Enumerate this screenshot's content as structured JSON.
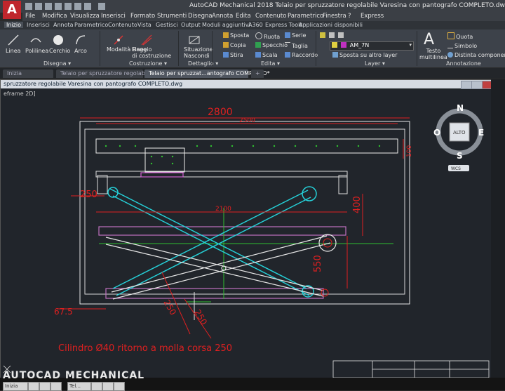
{
  "app": {
    "logo_letter": "A",
    "title": "AutoCAD Mechanical 2018     Telaio per spruzzatore regolabile Varesina con pantografo COMPLETO.dwg"
  },
  "menu": [
    "File",
    "Modifica",
    "Visualizza",
    "Inserisci",
    "Formato",
    "Strumenti",
    "Disegna",
    "Annota",
    "Edita",
    "Contenuto",
    "Parametrico",
    "Finestra",
    "?",
    "Express"
  ],
  "ribbon_tabs": [
    "Inizio",
    "Inserisci",
    "Annota",
    "Parametrico",
    "Contenuto",
    "Vista",
    "Gestisci",
    "Output",
    "Moduli aggiuntivi",
    "A360",
    "Express Tools",
    "Applicazioni disponibili"
  ],
  "ribbon": {
    "disegna": {
      "title": "Disegna ▾",
      "linea": "Linea",
      "polilinea": "Polilinea",
      "cerchio": "Cerchio",
      "arco": "Arco"
    },
    "costruzione": {
      "title": "Costruzione ▾",
      "modalita": "Modalità\nRaggio",
      "linee": "Linee\ndi costruzione"
    },
    "dettaglio": {
      "title": "Dettaglio ▾",
      "situazione": "Situazione\nNascondi"
    },
    "edita": {
      "title": "Edita ▾",
      "sposta": "Sposta",
      "ruota": "Ruota",
      "serie": "Serie",
      "copia": "Copia",
      "specchio": "Specchio",
      "taglia": "Taglia",
      "stira": "Stira",
      "scala": "Scala",
      "raccordo": "Raccordo"
    },
    "layer": {
      "title": "Layer ▾",
      "current": "AM_7N",
      "sposta_layer": "Sposta su altro layer"
    },
    "annotazione": {
      "title": "Annotazione",
      "testo": "Testo\nmultilinea",
      "quota": "Quota",
      "simbolo": "Simbolo",
      "distinta": "Distinta componenti"
    }
  },
  "doc_tabs": [
    "Inizia",
    "Telaio per spruzzatore regolabile*",
    "Telaio per spruzzat...antografo COMPLETO*"
  ],
  "drawing": {
    "window_title": "spruzzatore regolabile Varesina con pantografo COMPLETO.dwg",
    "viewport_label": "eframe 2D]",
    "viewcube": {
      "north": "N",
      "south": "S",
      "east": "E",
      "west": "O",
      "face": "ALTO",
      "wcs": "WCS"
    },
    "dimensions": {
      "d2800": "2800",
      "d2500": "2500",
      "d2100": "2100",
      "d400": "400",
      "d550": "550",
      "d250": "250",
      "d675": "67.5",
      "d100": "100",
      "d500a": "250",
      "d500b": "250"
    },
    "note": "Cilindro Ø40 ritorno a molla corsa 250"
  },
  "footer_text": "AUTOCAD MECHANICAL",
  "taskbar": [
    "Inizia",
    "Tel..."
  ],
  "colors": {
    "accent": "#c0262c",
    "cyan": "#25d0d8",
    "red": "#e02020",
    "magenta": "#d060d0",
    "green": "#30c030",
    "white": "#f0f0f0",
    "yellow": "#e0e020"
  }
}
